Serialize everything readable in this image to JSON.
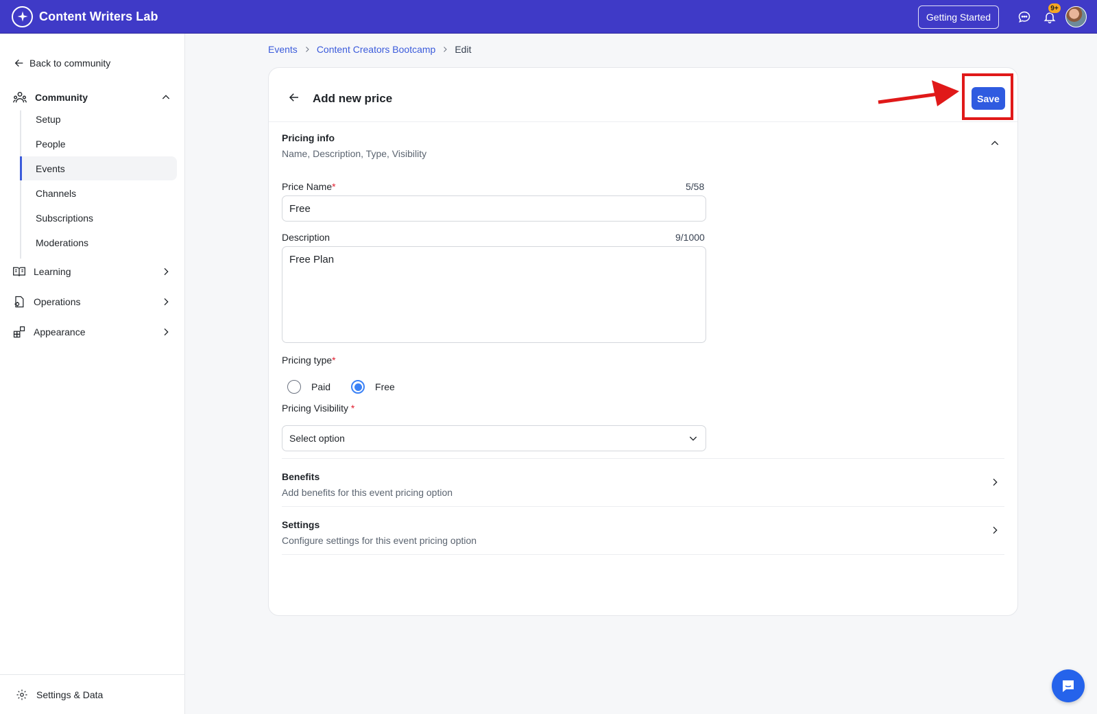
{
  "app": {
    "name": "Content Writers Lab"
  },
  "topbar": {
    "getting_started": "Getting Started",
    "notifications_badge": "9+"
  },
  "sidebar": {
    "back_link": "Back to community",
    "sections": [
      {
        "label": "Community",
        "icon": "community-icon",
        "expanded": true
      },
      {
        "label": "Learning",
        "icon": "book-icon",
        "expanded": false
      },
      {
        "label": "Operations",
        "icon": "operations-icon",
        "expanded": false
      },
      {
        "label": "Appearance",
        "icon": "appearance-icon",
        "expanded": false
      }
    ],
    "community_items": [
      "Setup",
      "People",
      "Events",
      "Channels",
      "Subscriptions",
      "Moderations"
    ],
    "active_item": "Events",
    "bottom": "Settings & Data"
  },
  "breadcrumb": {
    "items": [
      "Events",
      "Content Creators Bootcamp"
    ],
    "current": "Edit"
  },
  "form": {
    "title": "Add new price",
    "save_label": "Save",
    "pricing_info": {
      "title": "Pricing info",
      "subtitle": "Name, Description, Type, Visibility"
    },
    "price_name": {
      "label": "Price Name",
      "required": "*",
      "counter": "5/58",
      "value": "Free"
    },
    "description": {
      "label": "Description",
      "counter": "9/1000",
      "value": "Free Plan"
    },
    "pricing_type": {
      "label": "Pricing type",
      "required": "*",
      "options": [
        "Paid",
        "Free"
      ],
      "selected": "Free"
    },
    "pricing_visibility": {
      "label": "Pricing Visibility",
      "required": "*",
      "placeholder": "Select option"
    },
    "benefits": {
      "title": "Benefits",
      "subtitle": "Add benefits for this event pricing option"
    },
    "settings": {
      "title": "Settings",
      "subtitle": "Configure settings for this event pricing option"
    }
  },
  "colors": {
    "topbar": "#3f3ac7",
    "accent": "#3b5bdb",
    "save_button": "#2f5be0",
    "annotation": "#e01919"
  }
}
